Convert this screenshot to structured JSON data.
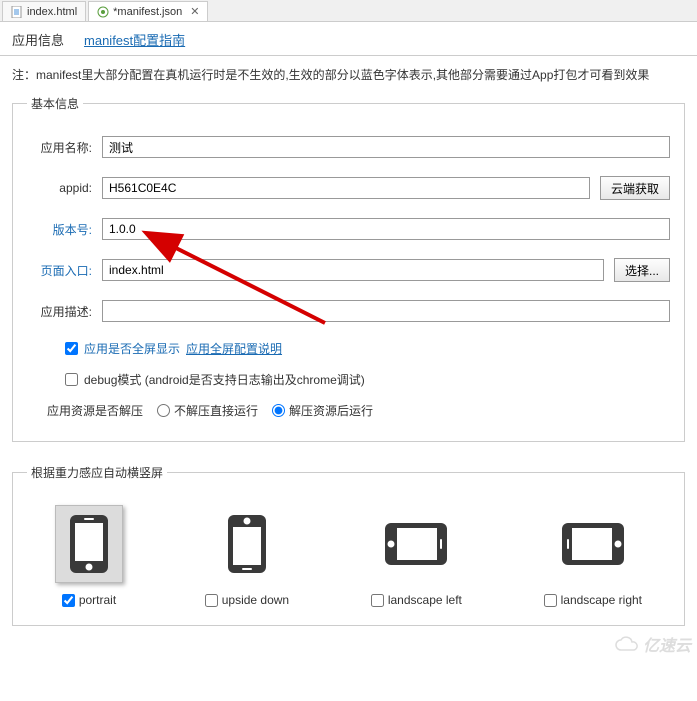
{
  "fileTabs": {
    "tab1": "index.html",
    "tab2": "*manifest.json"
  },
  "subTabs": {
    "appInfo": "应用信息",
    "guide": "manifest配置指南"
  },
  "note": "注：manifest里大部分配置在真机运行时是不生效的,生效的部分以蓝色字体表示,其他部分需要通过App打包才可看到效果",
  "basic": {
    "legend": "基本信息",
    "appNameLabel": "应用名称:",
    "appNameValue": "测试",
    "appidLabel": "appid:",
    "appidValue": "H561C0E4C",
    "cloudBtn": "云端获取",
    "versionLabel": "版本号:",
    "versionValue": "1.0.0",
    "entryLabel": "页面入口:",
    "entryValue": "index.html",
    "selectBtn": "选择...",
    "descLabel": "应用描述:",
    "descValue": "",
    "fullscreenLabel": "应用是否全屏显示",
    "fullscreenHelp": "应用全屏配置说明",
    "debugLabel": "debug模式 (android是否支持日志输出及chrome调试)",
    "unpackLabel": "应用资源是否解压",
    "unpackOpt1": "不解压直接运行",
    "unpackOpt2": "解压资源后运行"
  },
  "orient": {
    "legend": "根据重力感应自动横竖屏",
    "portrait": "portrait",
    "upside": "upside down",
    "landLeft": "landscape left",
    "landRight": "landscape right"
  },
  "watermark": "亿速云"
}
